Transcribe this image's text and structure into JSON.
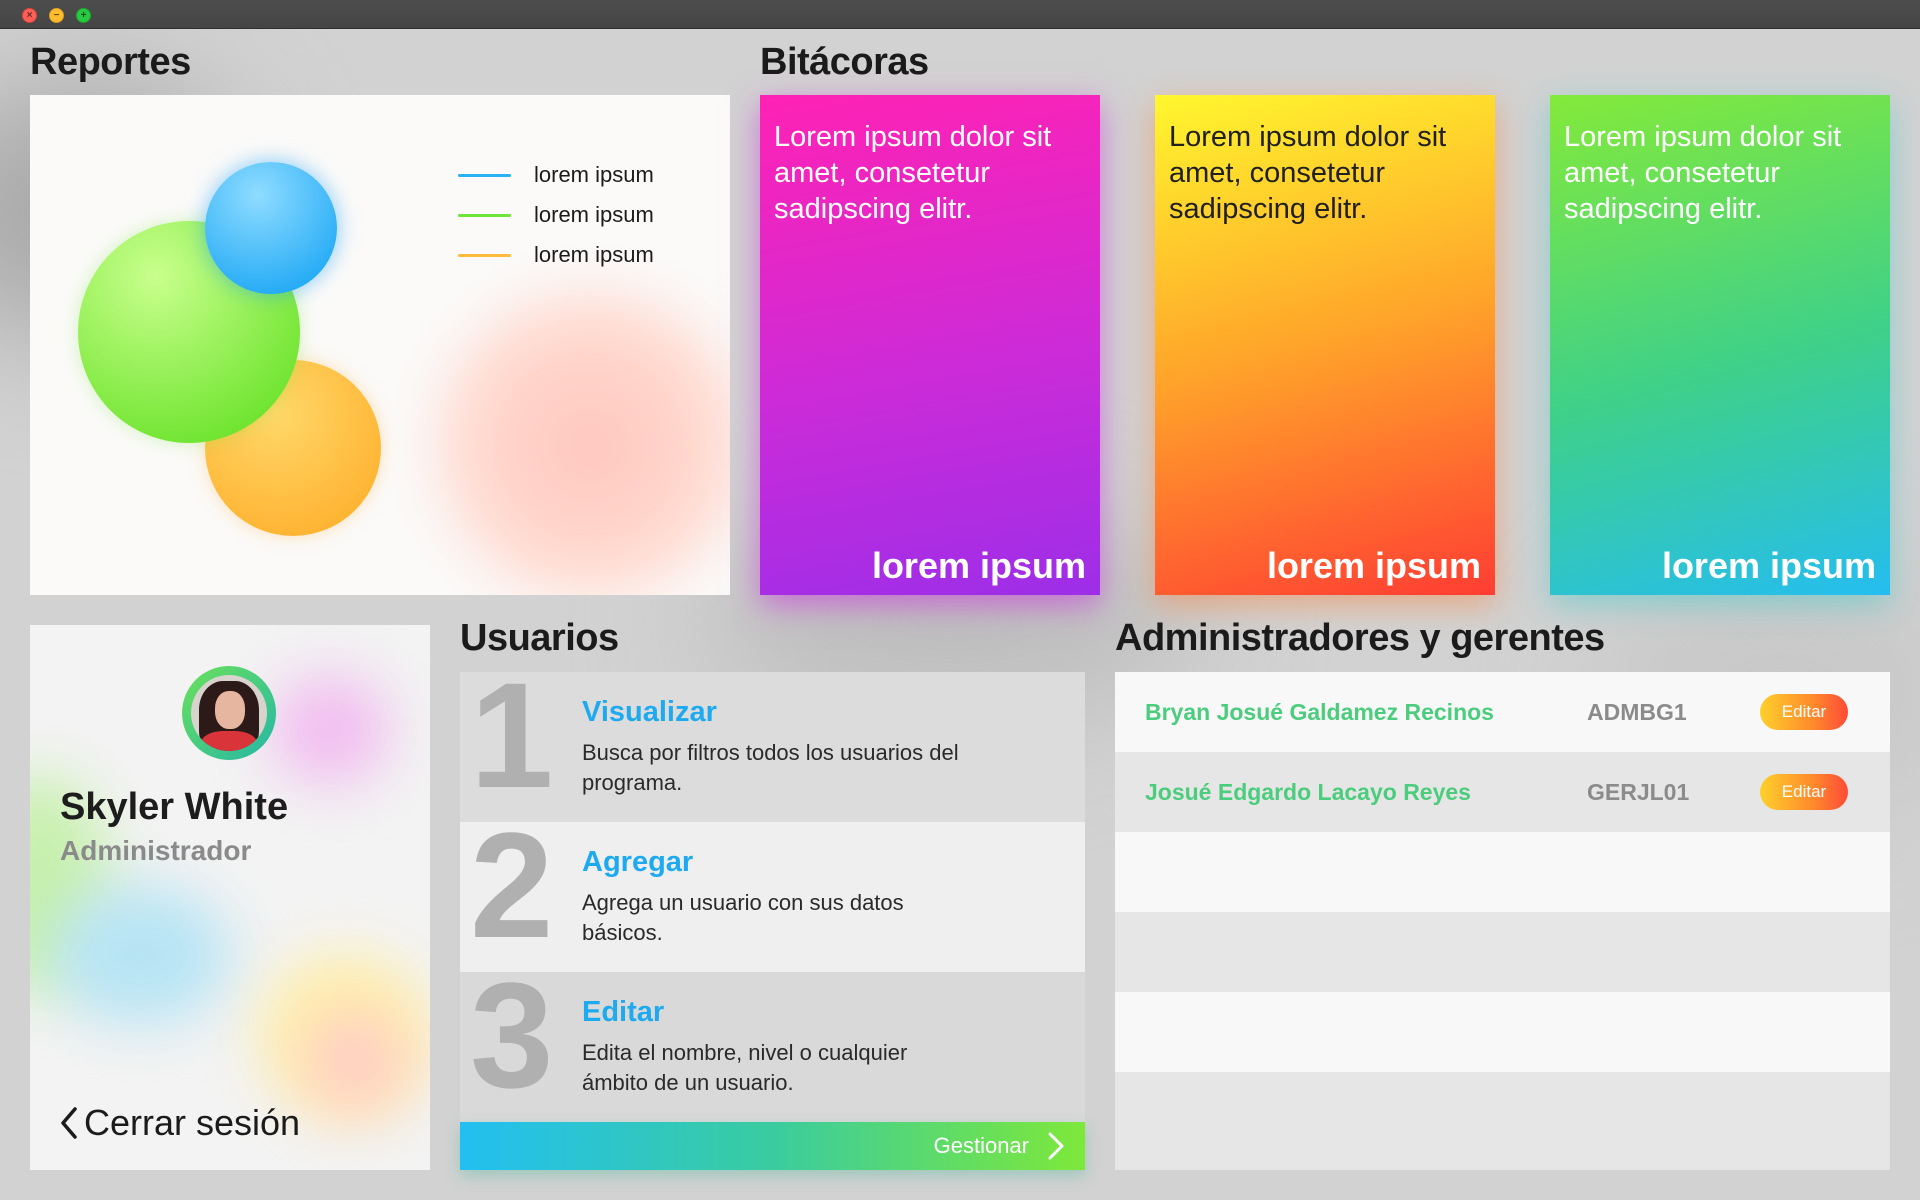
{
  "reportes": {
    "title": "Reportes",
    "legend": [
      {
        "label": "lorem ipsum",
        "color": "#27b3f4"
      },
      {
        "label": "lorem ipsum",
        "color": "#6fe43a"
      },
      {
        "label": "lorem ipsum",
        "color": "#ffbc3c"
      }
    ]
  },
  "bitacoras": {
    "title": "Bitácoras",
    "cards": [
      {
        "text": "Lorem ipsum dolor sit amet, consetetur sadipscing elitr.",
        "footer": "lorem ipsum"
      },
      {
        "text": "Lorem ipsum dolor sit amet, consetetur sadipscing elitr.",
        "footer": "lorem ipsum"
      },
      {
        "text": "Lorem ipsum dolor sit amet, consetetur sadipscing elitr.",
        "footer": "lorem ipsum"
      }
    ]
  },
  "profile": {
    "name": "Skyler White",
    "role": "Administrador",
    "logout_label": "Cerrar sesión"
  },
  "usuarios": {
    "title": "Usuarios",
    "rows": [
      {
        "number": "1",
        "title": "Visualizar",
        "description": "Busca por filtros todos los usuarios del programa."
      },
      {
        "number": "2",
        "title": "Agregar",
        "description": "Agrega un usuario con sus datos básicos."
      },
      {
        "number": "3",
        "title": "Editar",
        "description": "Edita el nombre, nivel o cualquier ámbito de un usuario."
      }
    ],
    "manage_label": "Gestionar"
  },
  "administradores": {
    "title": "Administradores y gerentes",
    "rows": [
      {
        "name": "Bryan Josué Galdamez Recinos",
        "code": "ADMBG1",
        "edit_label": "Editar"
      },
      {
        "name": "Josué Edgardo Lacayo Reyes",
        "code": "GERJL01",
        "edit_label": "Editar"
      }
    ]
  }
}
